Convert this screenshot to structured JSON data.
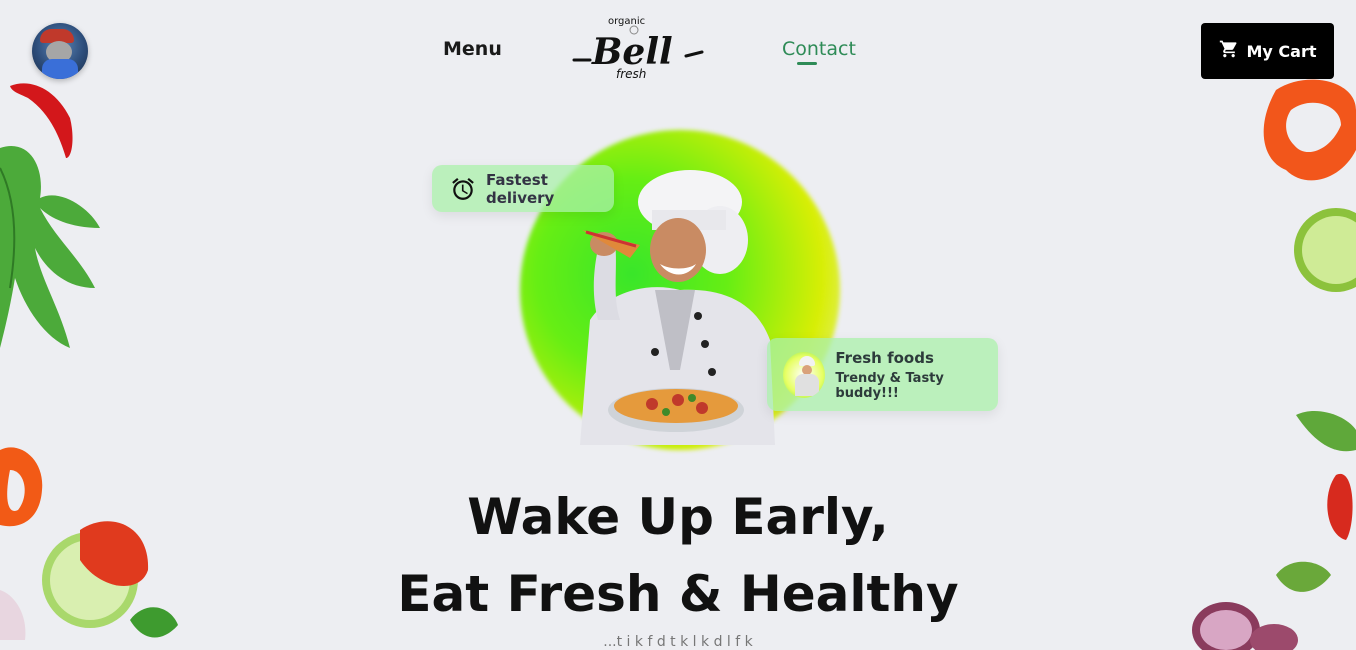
{
  "header": {
    "nav": {
      "menu_label": "Menu",
      "contact_label": "Contact"
    },
    "logo": {
      "top_text": "organic",
      "main_text": "Bell",
      "bottom_text": "fresh"
    },
    "cart": {
      "label": "My Cart",
      "icon": "cart-icon"
    }
  },
  "hero": {
    "badges": {
      "delivery": {
        "label": "Fastest delivery",
        "icon": "alarm-clock-icon"
      },
      "fresh": {
        "title": "Fresh foods",
        "subtitle": "Trendy & Tasty buddy!!!"
      }
    },
    "headline_line1": "Wake Up Early,",
    "headline_line2": "Eat Fresh & Healthy",
    "subtext": "...t i   k   f              d   t           k    l       k    d            l  f           k    "
  },
  "colors": {
    "background": "#edeef2",
    "accent_green": "#2e8b57",
    "cart_bg": "#000000",
    "badge_bg": "#aaf0aa"
  }
}
